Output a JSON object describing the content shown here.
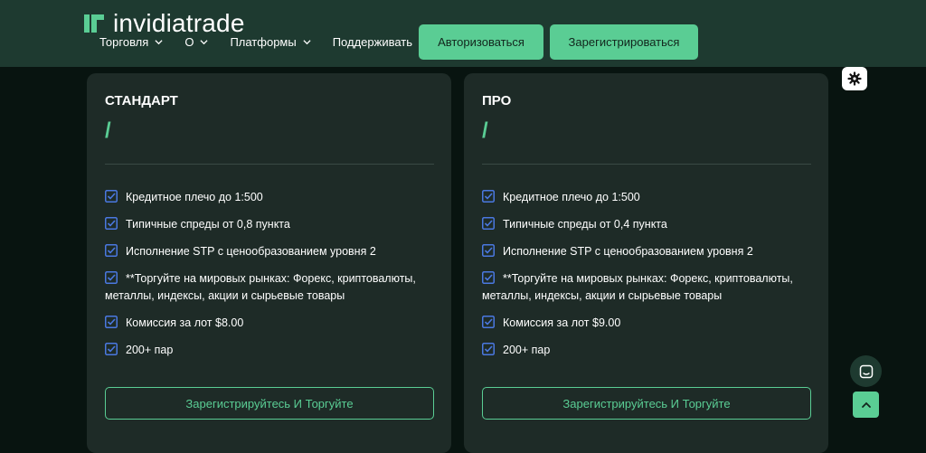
{
  "header": {
    "logo_text": "invidiatrade",
    "nav": [
      {
        "label": "Торговля",
        "has_dropdown": true
      },
      {
        "label": "О",
        "has_dropdown": true
      },
      {
        "label": "Платформы",
        "has_dropdown": true
      },
      {
        "label": "Поддерживать",
        "has_dropdown": false
      }
    ],
    "login_label": "Авторизоваться",
    "register_label": "Зарегистрироваться"
  },
  "plans": [
    {
      "title": "СТАНДАРТ",
      "price": "/",
      "features": [
        "Кредитное плечо до 1:500",
        "Типичные спреды от 0,8 пункта",
        "Исполнение STP с ценообразованием уровня 2",
        "**Торгуйте на мировых рынках: Форекс, криптовалюты, металлы, индексы, акции и сырьевые товары",
        "Комиссия за лот $8.00",
        "200+ пар"
      ],
      "cta": "Зарегистрируйтесь И Торгуйте"
    },
    {
      "title": "ПРО",
      "price": "/",
      "features": [
        "Кредитное плечо до 1:500",
        "Типичные спреды от 0,4 пункта",
        "Исполнение STP с ценообразованием уровня 2",
        "**Торгуйте на мировых рынках: Форекс, криптовалюты, металлы, индексы, акции и сырьевые товары",
        "Комиссия за лот $9.00",
        "200+ пар"
      ],
      "cta": "Зарегистрируйтесь И Торгуйте"
    }
  ],
  "colors": {
    "accent": "#5acd94",
    "header_bg": "#1e3a30",
    "page_bg": "#081410",
    "card_bg": "#1e2b27",
    "check_icon": "#4a78e0"
  },
  "icons": {
    "theme_toggle": "gear-icon",
    "chat": "chat-icon",
    "scroll_top": "chevron-up-icon",
    "feature": "checkbox-check-icon"
  }
}
